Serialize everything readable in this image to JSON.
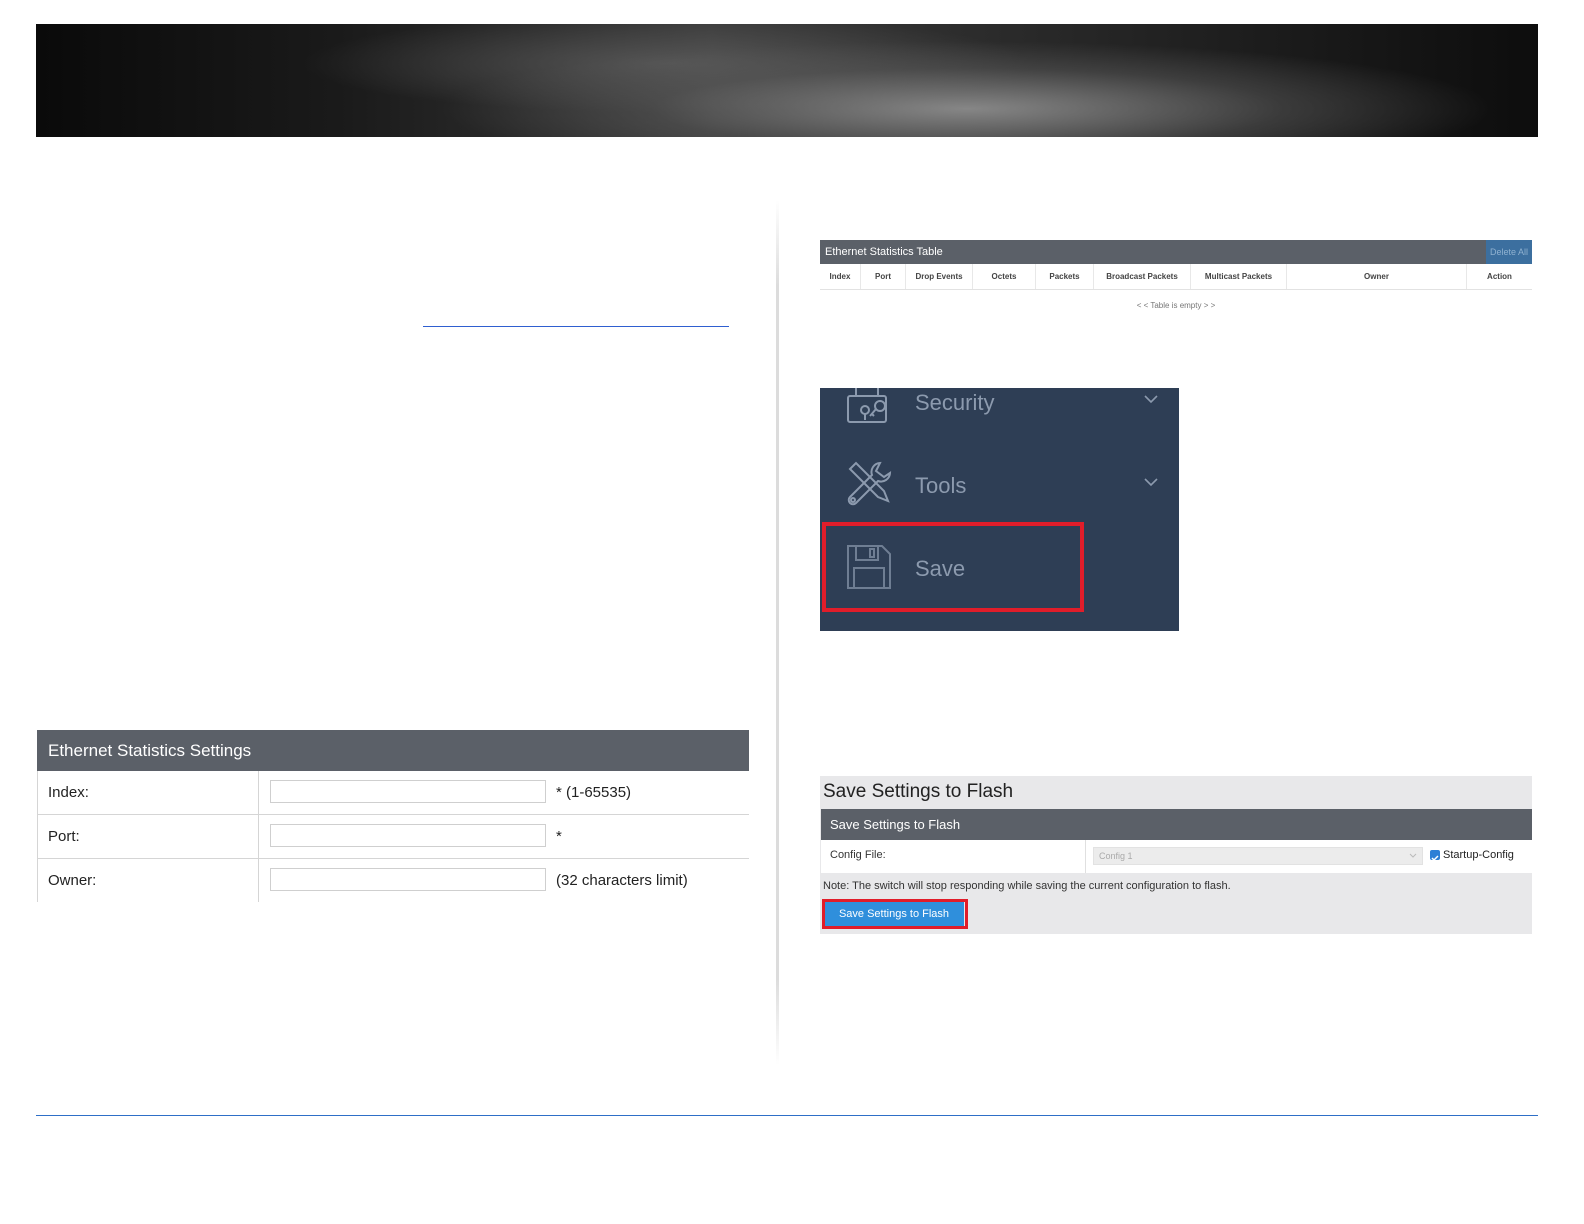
{
  "settings_form": {
    "title": "Ethernet Statistics Settings",
    "rows": [
      {
        "label": "Index:",
        "value": "",
        "hint": "* (1-65535)"
      },
      {
        "label": "Port:",
        "value": "",
        "hint": "*"
      },
      {
        "label": "Owner:",
        "value": "",
        "hint": "(32 characters limit)"
      }
    ]
  },
  "stats_table": {
    "title": "Ethernet Statistics Table",
    "delete_all_label": "Delete All",
    "columns": [
      "Index",
      "Port",
      "Drop Events",
      "Octets",
      "Packets",
      "Broadcast Packets",
      "Multicast Packets",
      "Owner",
      "Action"
    ],
    "empty_message": "< < Table is empty > >"
  },
  "menu": {
    "items": [
      {
        "label": "Security",
        "icon": "security-lock-icon",
        "has_chevron": true
      },
      {
        "label": "Tools",
        "icon": "tools-icon",
        "has_chevron": true
      },
      {
        "label": "Save",
        "icon": "save-floppy-icon",
        "has_chevron": false,
        "highlighted": true
      }
    ]
  },
  "save_flash": {
    "page_title": "Save Settings to Flash",
    "section_title": "Save Settings to Flash",
    "config_file_label": "Config File:",
    "config_file_value": "Config 1",
    "startup_config_label": "Startup-Config",
    "startup_config_checked": true,
    "note": "Note: The switch will stop responding while saving the current configuration to flash.",
    "button_label": "Save Settings to Flash"
  },
  "colors": {
    "panel_header": "#5b6068",
    "menu_background": "#2e3e55",
    "highlight_red": "#e11d2a",
    "button_blue": "#2f8fdc",
    "link_blue": "#2f5fd0"
  }
}
